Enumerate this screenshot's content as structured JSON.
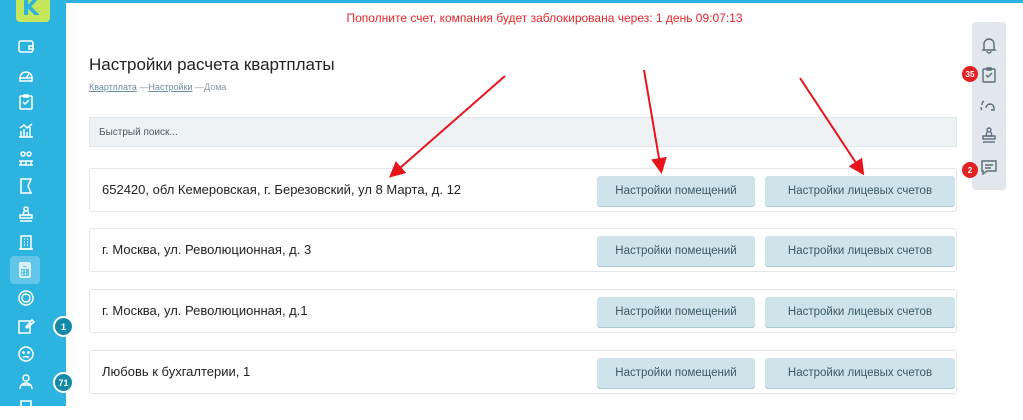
{
  "notice": "Пополните счет, компания будет заблокирована через: 1 день 09:07:13",
  "page_title": "Настройки расчета квартплаты",
  "breadcrumb": {
    "item1": "Квартплата",
    "sep": "—",
    "item2": "Настройки",
    "item3": "Дома"
  },
  "search": {
    "placeholder": "Быстрый поиск..."
  },
  "houses": [
    {
      "address": "652420, обл Кемеровская, г. Березовский, ул 8 Марта, д. 12",
      "rooms_btn": "Настройки помещений",
      "accounts_btn": "Настройки лицевых счетов"
    },
    {
      "address": "г. Москва, ул. Революционная, д. 3",
      "rooms_btn": "Настройки помещений",
      "accounts_btn": "Настройки лицевых счетов"
    },
    {
      "address": "г. Москва, ул. Революционная, д.1",
      "rooms_btn": "Настройки помещений",
      "accounts_btn": "Настройки лицевых счетов"
    },
    {
      "address": "Любовь к бухгалтерии, 1",
      "rooms_btn": "Настройки помещений",
      "accounts_btn": "Настройки лицевых счетов"
    }
  ],
  "sidebar": {
    "badges": {
      "reports": "1",
      "users": "71"
    }
  },
  "right_panel": {
    "badges": {
      "tasks": "35",
      "messages": "2"
    }
  },
  "colors": {
    "sidebar": "#2cb3df",
    "logo": "#c4e65a",
    "notice": "#e8262b",
    "button": "#cfe4ea",
    "badge_red": "#e52222",
    "badge_teal": "#138aa6"
  }
}
